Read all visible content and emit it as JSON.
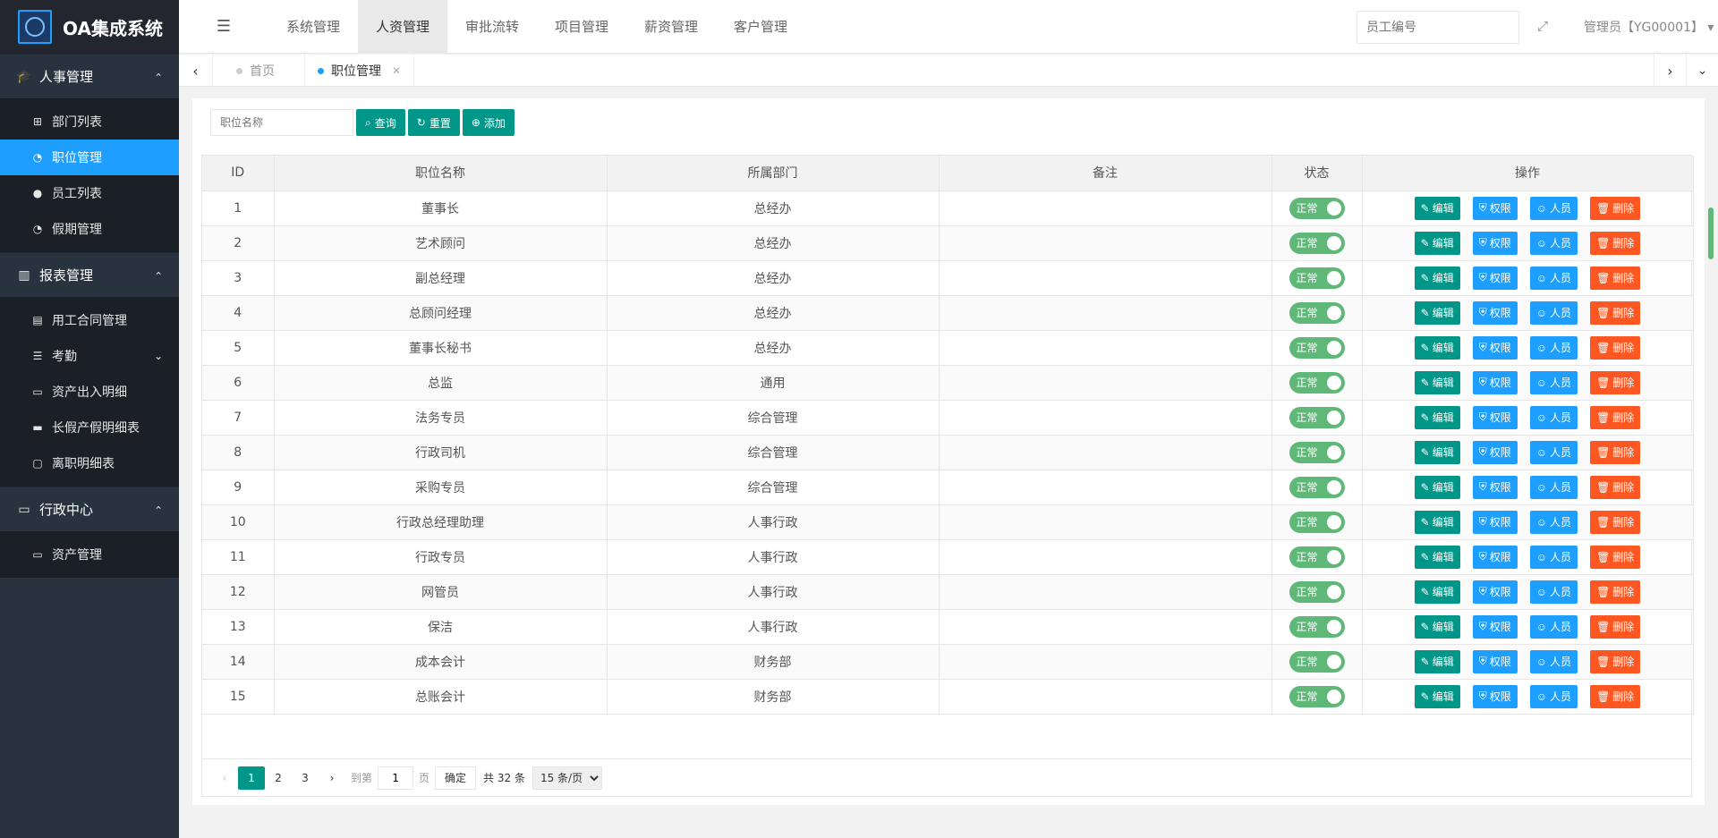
{
  "app": {
    "title": "OA集成系统"
  },
  "sidebar": {
    "groups": [
      {
        "title": "人事管理",
        "icon": "graduation-cap-icon",
        "items": [
          {
            "label": "部门列表",
            "icon": "sitemap-icon"
          },
          {
            "label": "职位管理",
            "icon": "dashboard-icon",
            "active": true
          },
          {
            "label": "员工列表",
            "icon": "user-icon"
          },
          {
            "label": "假期管理",
            "icon": "dashboard-icon"
          }
        ]
      },
      {
        "title": "报表管理",
        "icon": "bar-chart-icon",
        "items": [
          {
            "label": "用工合同管理",
            "icon": "document-icon"
          },
          {
            "label": "考勤",
            "icon": "list-icon"
          },
          {
            "label": "资产出入明细",
            "icon": "monitor-icon"
          },
          {
            "label": "长假产假明细表",
            "icon": "bed-icon"
          },
          {
            "label": "离职明细表",
            "icon": "trash-icon"
          }
        ]
      },
      {
        "title": "行政中心",
        "icon": "monitor-icon",
        "items": [
          {
            "label": "资产管理",
            "icon": "monitor-icon"
          }
        ]
      }
    ]
  },
  "header": {
    "tabs": [
      "系统管理",
      "人资管理",
      "审批流转",
      "项目管理",
      "薪资管理",
      "客户管理"
    ],
    "active_tab": "人资管理",
    "search_placeholder": "员工编号",
    "admin_label": "管理员【YG00001】"
  },
  "pagetabs": {
    "home": "首页",
    "current": "职位管理"
  },
  "toolbar": {
    "query_placeholder": "职位名称",
    "search_label": "查询",
    "reset_label": "重置",
    "add_label": "添加"
  },
  "table": {
    "columns": [
      "ID",
      "职位名称",
      "所属部门",
      "备注",
      "状态",
      "操作"
    ],
    "status_label": "正常",
    "op_labels": {
      "edit": "编辑",
      "perm": "权限",
      "staff": "人员",
      "del": "删除"
    },
    "rows": [
      {
        "id": "1",
        "name": "董事长",
        "dept": "总经办",
        "note": ""
      },
      {
        "id": "2",
        "name": "艺术顾问",
        "dept": "总经办",
        "note": ""
      },
      {
        "id": "3",
        "name": "副总经理",
        "dept": "总经办",
        "note": ""
      },
      {
        "id": "4",
        "name": "总顾问经理",
        "dept": "总经办",
        "note": ""
      },
      {
        "id": "5",
        "name": "董事长秘书",
        "dept": "总经办",
        "note": ""
      },
      {
        "id": "6",
        "name": "总监",
        "dept": "通用",
        "note": ""
      },
      {
        "id": "7",
        "name": "法务专员",
        "dept": "综合管理",
        "note": ""
      },
      {
        "id": "8",
        "name": "行政司机",
        "dept": "综合管理",
        "note": ""
      },
      {
        "id": "9",
        "name": "采购专员",
        "dept": "综合管理",
        "note": ""
      },
      {
        "id": "10",
        "name": "行政总经理助理",
        "dept": "人事行政",
        "note": ""
      },
      {
        "id": "11",
        "name": "行政专员",
        "dept": "人事行政",
        "note": ""
      },
      {
        "id": "12",
        "name": "网管员",
        "dept": "人事行政",
        "note": ""
      },
      {
        "id": "13",
        "name": "保洁",
        "dept": "人事行政",
        "note": ""
      },
      {
        "id": "14",
        "name": "成本会计",
        "dept": "财务部",
        "note": ""
      },
      {
        "id": "15",
        "name": "总账会计",
        "dept": "财务部",
        "note": ""
      }
    ]
  },
  "pager": {
    "pages": [
      "1",
      "2",
      "3"
    ],
    "current": "1",
    "goto_label": "到第",
    "goto_value": "1",
    "page_unit": "页",
    "ok_label": "确定",
    "total_label": "共 32 条",
    "per_page": "15 条/页"
  },
  "colors": {
    "teal": "#009688",
    "blue": "#1e9fff",
    "orange": "#ff5722",
    "green": "#5fb878",
    "sidebar": "#28333f"
  }
}
